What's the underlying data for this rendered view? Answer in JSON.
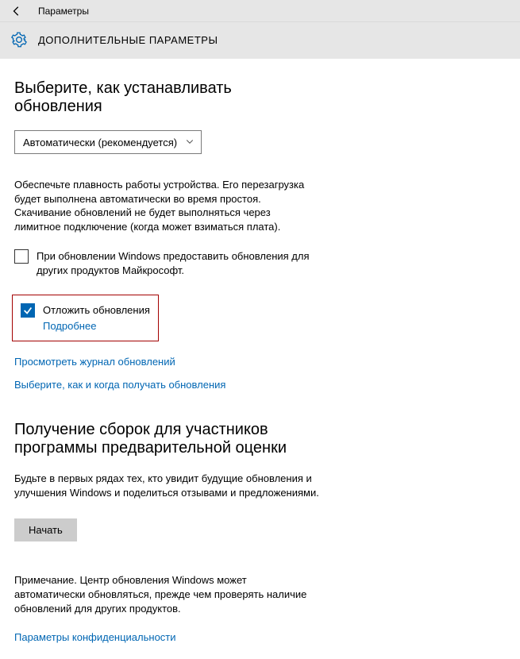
{
  "titlebar": {
    "text": "Параметры"
  },
  "header": {
    "title": "ДОПОЛНИТЕЛЬНЫЕ ПАРАМЕТРЫ"
  },
  "section1": {
    "heading": "Выберите, как устанавливать обновления",
    "select_value": "Автоматически (рекомендуется)",
    "description": "Обеспечьте плавность работы устройства. Его перезагрузка будет выполнена автоматически во время простоя. Скачивание обновлений не будет выполняться через лимитное подключение (когда может взиматься плата).",
    "checkbox1_label": "При обновлении Windows предоставить обновления для других продуктов Майкрософт.",
    "checkbox2_label": "Отложить обновления",
    "more_link": "Подробнее",
    "link1": "Просмотреть журнал обновлений",
    "link2": "Выберите, как и когда получать обновления"
  },
  "section2": {
    "heading": "Получение сборок для участников программы предварительной оценки",
    "description": "Будьте в первых рядах тех, кто увидит будущие обновления и улучшения Windows и поделиться отзывами и предложениями.",
    "button": "Начать",
    "note": "Примечание. Центр обновления Windows может автоматически обновляться, прежде чем проверять наличие обновлений для других продуктов.",
    "privacy_link": "Параметры конфиденциальности"
  }
}
